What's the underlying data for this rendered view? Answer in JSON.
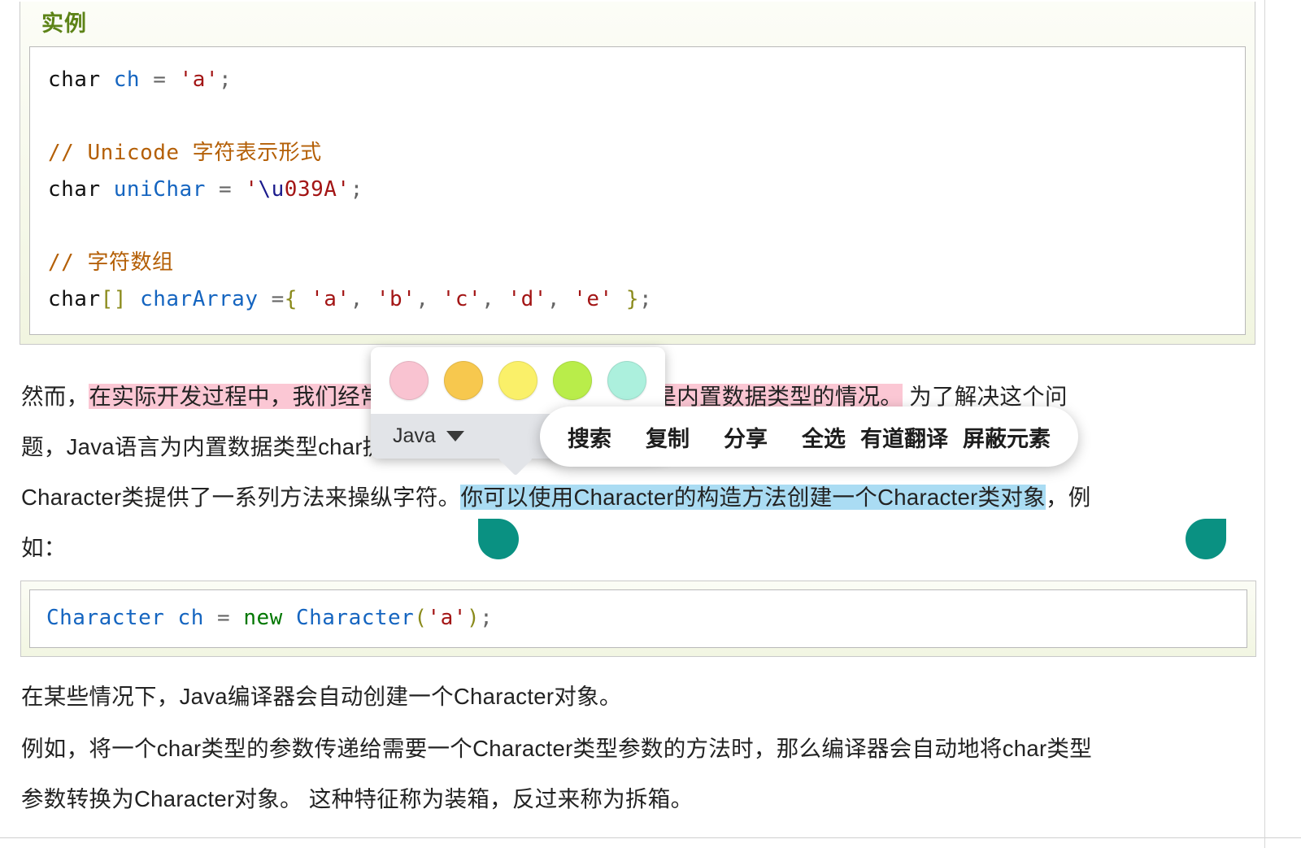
{
  "example": {
    "title": "实例",
    "code_lines": [
      [
        {
          "t": "char ",
          "c": "kw"
        },
        {
          "t": "ch",
          "c": "var"
        },
        {
          "t": " = ",
          "c": "op"
        },
        {
          "t": "'a'",
          "c": "str"
        },
        {
          "t": ";",
          "c": "op"
        }
      ],
      [],
      [
        {
          "t": "// Unicode 字符表示形式",
          "c": "cmt"
        }
      ],
      [
        {
          "t": "char ",
          "c": "kw"
        },
        {
          "t": "uniChar",
          "c": "var"
        },
        {
          "t": " = ",
          "c": "op"
        },
        {
          "t": "'",
          "c": "str"
        },
        {
          "t": "\\u",
          "c": "esc"
        },
        {
          "t": "039A'",
          "c": "str"
        },
        {
          "t": ";",
          "c": "op"
        }
      ],
      [],
      [
        {
          "t": "// 字符数组",
          "c": "cmt"
        }
      ],
      [
        {
          "t": "char",
          "c": "kw"
        },
        {
          "t": "[]",
          "c": "brk"
        },
        {
          "t": " ",
          "c": "kw"
        },
        {
          "t": "charArray",
          "c": "var"
        },
        {
          "t": " =",
          "c": "op"
        },
        {
          "t": "{",
          "c": "brk"
        },
        {
          "t": " 'a'",
          "c": "str"
        },
        {
          "t": ",",
          "c": "op"
        },
        {
          "t": " 'b'",
          "c": "str"
        },
        {
          "t": ",",
          "c": "op"
        },
        {
          "t": " 'c'",
          "c": "str"
        },
        {
          "t": ",",
          "c": "op"
        },
        {
          "t": " 'd'",
          "c": "str"
        },
        {
          "t": ",",
          "c": "op"
        },
        {
          "t": " 'e' ",
          "c": "str"
        },
        {
          "t": "}",
          "c": "brk"
        },
        {
          "t": ";",
          "c": "op"
        }
      ]
    ],
    "code_plain": "char ch = 'a';\n\n// Unicode 字符表示形式\nchar uniChar = '\\u039A';\n\n// 字符数组\nchar[] charArray ={ 'a', 'b', 'c', 'd', 'e' };"
  },
  "example2": {
    "code_lines": [
      [
        {
          "t": "Character",
          "c": "cls"
        },
        {
          "t": " ",
          "c": "kw"
        },
        {
          "t": "ch",
          "c": "var"
        },
        {
          "t": " = ",
          "c": "op"
        },
        {
          "t": "new",
          "c": "new"
        },
        {
          "t": " ",
          "c": "kw"
        },
        {
          "t": "Character",
          "c": "cls"
        },
        {
          "t": "(",
          "c": "brk"
        },
        {
          "t": "'a'",
          "c": "str"
        },
        {
          "t": ")",
          "c": "brk"
        },
        {
          "t": ";",
          "c": "op"
        }
      ]
    ],
    "code_plain": "Character ch = new Character('a');"
  },
  "paragraphs": {
    "p1_a": "然而，",
    "p1_b": "在实际开发过程中，我们经常会遇到需要使用对象",
    "p1_c": "，而不是内置数据类型的情况。",
    "p1_d": " 为了解决这个问",
    "p2": "题，Java语言为内置数据类型char提供了包装类Character类。",
    "p3_a": "Character类提供了一系列方法来操纵字符。",
    "p3_b": "你可以使用Character的构造方法创建一个Character类对象",
    "p3_c": "，例",
    "p4": "如：",
    "p5": "在某些情况下，Java编译器会自动创建一个Character对象。",
    "p6": "例如，将一个char类型的参数传递给需要一个Character类型参数的方法时，那么编译器会自动地将char类型",
    "p7": "参数转换为Character对象。 这种特征称为装箱，反过来称为拆箱。"
  },
  "highlight_popup": {
    "swatches": [
      {
        "name": "swatch-pink",
        "color": "#f9c3d1"
      },
      {
        "name": "swatch-orange",
        "color": "#f7c84e"
      },
      {
        "name": "swatch-yellow",
        "color": "#faf069"
      },
      {
        "name": "swatch-lime",
        "color": "#b9ed4a"
      },
      {
        "name": "swatch-mint",
        "color": "#acf0dd"
      }
    ],
    "language_label": "Java",
    "caret_icon": "chevron-down-icon"
  },
  "context_menu": {
    "items": [
      {
        "label": "搜索",
        "name": "ctx-search"
      },
      {
        "label": "复制",
        "name": "ctx-copy"
      },
      {
        "label": "分享",
        "name": "ctx-share"
      },
      {
        "label": "全选",
        "name": "ctx-select-all"
      },
      {
        "label": "有道翻译",
        "name": "ctx-youdao-translate"
      },
      {
        "label": "屏蔽元素",
        "name": "ctx-block-element"
      }
    ]
  },
  "colors": {
    "accent_green": "#5d8317",
    "highlight_pink": "#fbc7d4",
    "selection_blue": "#aadcf3",
    "handle_teal": "#0a9182",
    "panel_bg": "#f2f6e2"
  }
}
